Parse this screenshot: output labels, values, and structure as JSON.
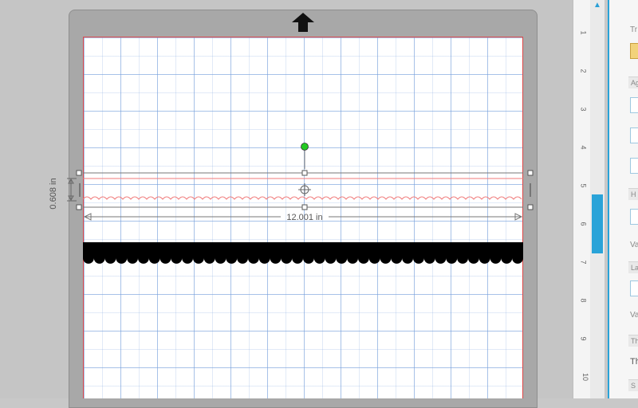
{
  "canvas": {
    "height_dimension": "0.608 in",
    "width_dimension": "12.001 in"
  },
  "ruler": {
    "numbers": [
      "1",
      "2",
      "3",
      "4",
      "5",
      "6",
      "7",
      "8",
      "9",
      "10"
    ]
  },
  "panel": {
    "tab_label": "Tr",
    "section_align": "Ag",
    "section_h": "H",
    "section_v_label": "Va",
    "section_la": "La",
    "section_va2": "Va",
    "section_th": "Th",
    "th_text": "Th",
    "section_s": "S"
  },
  "icons": {
    "feed_arrow": "arrow-up-icon",
    "rotation_handle": "rotate-handle-icon",
    "move_handle": "move-crosshair-icon",
    "scroll_up": "chevron-up-icon"
  },
  "colors": {
    "accent": "#29a3d8",
    "cut_line": "#e04848",
    "rotate_handle": "#22c922",
    "border_shape": "#000000"
  }
}
